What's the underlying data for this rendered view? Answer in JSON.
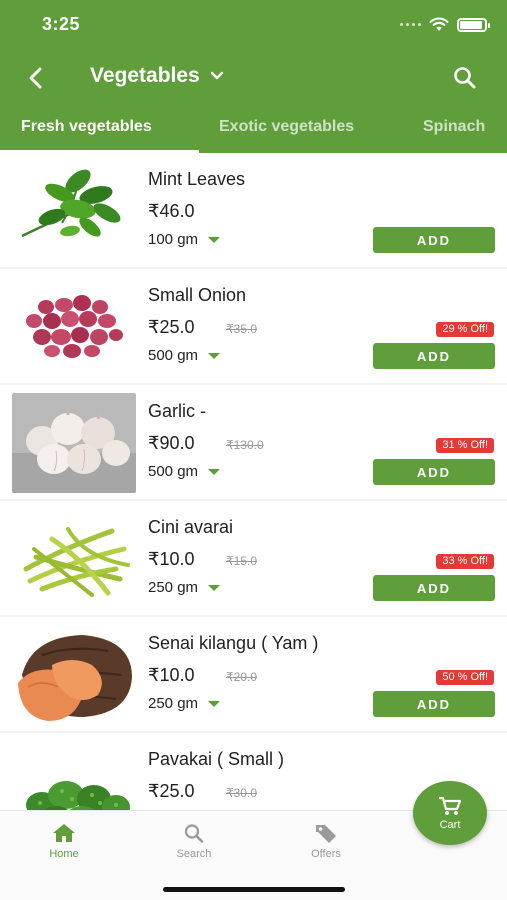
{
  "status_bar": {
    "time": "3:25"
  },
  "header": {
    "title": "Vegetables"
  },
  "tabs": [
    {
      "label": "Fresh vegetables",
      "active": true
    },
    {
      "label": "Exotic vegetables",
      "active": false
    },
    {
      "label": "Spinach",
      "active": false
    }
  ],
  "products": [
    {
      "name": "Mint Leaves",
      "price": "₹46.0",
      "mrp": "",
      "discount": "",
      "quantity": "100 gm",
      "add_label": "ADD"
    },
    {
      "name": "Small Onion",
      "price": "₹25.0",
      "mrp": "₹35.0",
      "discount": "29 % Off!",
      "quantity": "500 gm",
      "add_label": "ADD"
    },
    {
      "name": "Garlic -",
      "price": "₹90.0",
      "mrp": "₹130.0",
      "discount": "31 % Off!",
      "quantity": "500 gm",
      "add_label": "ADD"
    },
    {
      "name": "Cini avarai",
      "price": "₹10.0",
      "mrp": "₹15.0",
      "discount": "33 % Off!",
      "quantity": "250 gm",
      "add_label": "ADD"
    },
    {
      "name": "Senai kilangu ( Yam )",
      "price": "₹10.0",
      "mrp": "₹20.0",
      "discount": "50 % Off!",
      "quantity": "250 gm",
      "add_label": "ADD"
    },
    {
      "name": "Pavakai ( Small )",
      "price": "₹25.0",
      "mrp": "₹30.0",
      "discount": "",
      "quantity": "",
      "add_label": ""
    }
  ],
  "bottom_nav": {
    "items": [
      {
        "label": "Home",
        "icon": "home-icon",
        "active": true
      },
      {
        "label": "Search",
        "icon": "search-icon",
        "active": false
      },
      {
        "label": "Offers",
        "icon": "tag-icon",
        "active": false
      }
    ],
    "cart_label": "Cart"
  },
  "colors": {
    "primary": "#5f9e3a",
    "discount_badge": "#e53935"
  }
}
